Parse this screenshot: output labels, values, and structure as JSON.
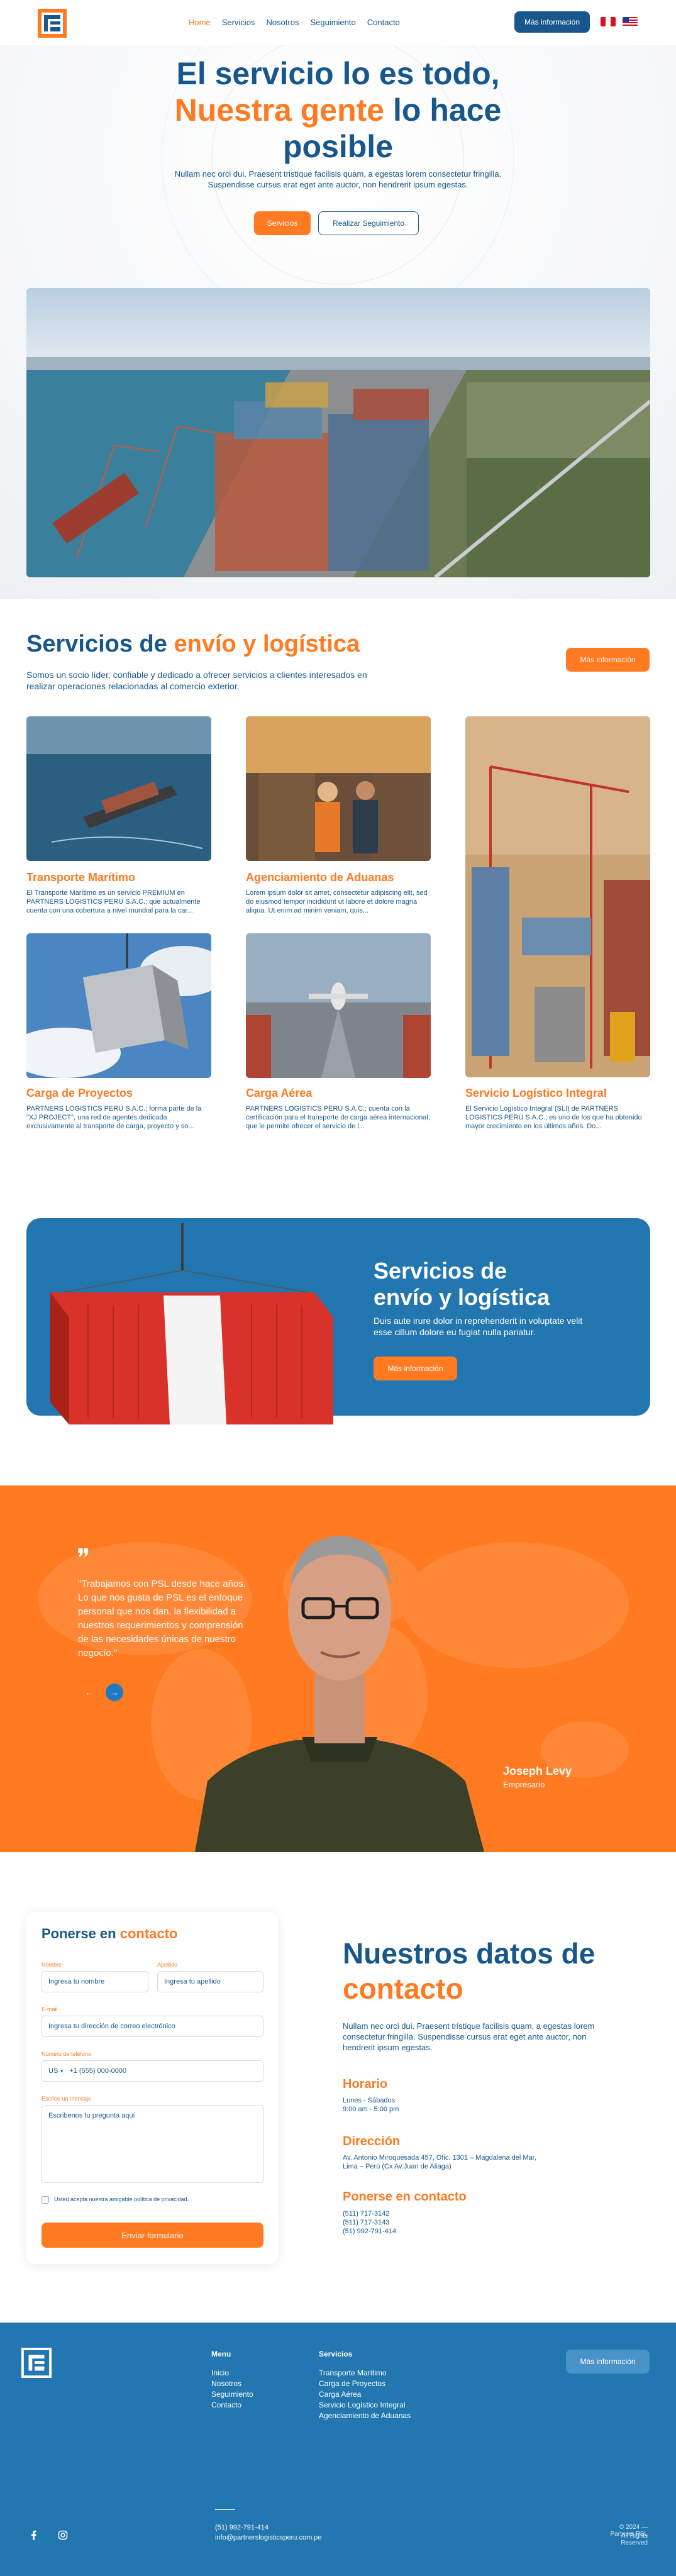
{
  "nav": {
    "items": [
      "Home",
      "Servicios",
      "Nosotros",
      "Seguimiento",
      "Contacto"
    ],
    "cta": "Más información"
  },
  "hero": {
    "title_line1": "El servicio lo es todo,",
    "title_line2_orange": "Nuestra gente",
    "title_line2_blue": "lo hace",
    "title_line3": "posible",
    "subtitle": "Nullam nec orci dui. Praesent tristique facilisis quam, a egestas lorem consectetur fringilla. Suspendisse cursus erat eget ante auctor, non hendrerit ipsum egestas.",
    "btn_primary": "Servicios",
    "btn_secondary": "Realizar Seguimiento"
  },
  "services": {
    "title_blue": "Servicios de",
    "title_orange": "envío y logística",
    "subtitle": "Somos un socio líder, confiable y dedicado a ofrecer servicios a clientes interesados en realizar operaciones relacionadas al comercio exterior.",
    "cta": "Más información",
    "cards": [
      {
        "title": "Transporte Marítimo",
        "text": "El Transporte Marítimo es un servicio PREMIUM en PARTNERS LOGISTICS PERU S.A.C.; que actualmente cuenta con una cobertura a nivel mundial para la car..."
      },
      {
        "title": "Agenciamiento de Aduanas",
        "text": "Lorem ipsum dolor sit amet, consectetur adipiscing elit, sed do eiusmod tempor incididunt ut labore et dolore magna aliqua. Ut enim ad minim veniam, quis..."
      },
      {
        "title": "Servicio Logístico Integral",
        "text": "El Servicio Logístico Integral (SLI) de PARTNERS LOGISTICS PERU S.A.C.; es uno de los que ha obtenido mayor crecimiento en los últimos años. Do..."
      },
      {
        "title": "Carga de Proyectos",
        "text": "PARTNERS LOGISTICS PERU S.A.C.; forma parte de la \"XJ PROJECT\", una red de agentes dedicada exclusivamente al transporte de carga, proyecto y so..."
      },
      {
        "title": "Carga Aérea",
        "text": "PARTNERS LOGISTICS PERU S.A.C.; cuenta con la certificación para el transporte de carga aérea internacional, que le permite ofrecer el servicio de l..."
      }
    ]
  },
  "banner": {
    "title_line1": "Servicios de",
    "title_line2": "envío y logística",
    "text": "Duis aute irure dolor in reprehenderit in voluptate velit esse cillum dolore eu fugiat nulla pariatur.",
    "cta": "Más información"
  },
  "testimonial": {
    "quote_mark": "❞",
    "text": "\"Trabajamos con PSL desde hace años. Lo que nos gusta de PSL es el enfoque personal que nos dan, la flexibilidad a nuestros requerimientos y comprensión de las necesidades únicas de nuestro negocio.\"",
    "name": "Joseph Levy",
    "role": "Empresario"
  },
  "form": {
    "title_blue": "Ponerse en",
    "title_orange": "contacto",
    "name_label": "Nombre",
    "name_placeholder": "Ingresa tu nombre",
    "last_label": "Apellido",
    "last_placeholder": "Ingresa tu apellido",
    "email_label": "E-mail",
    "email_placeholder": "Ingresa tu dirección de correo electrónico",
    "phone_label": "Número de teléfono",
    "phone_country": "US",
    "phone_placeholder": "+1 (555) 000-0000",
    "msg_label": "Escribe un mensaje",
    "msg_placeholder": "Escribenos tu pregunta aquí",
    "privacy": "Usted acepta nuestra amigable política de privacidad.",
    "submit": "Enviar formulario"
  },
  "info": {
    "title_blue": "Nuestros datos de",
    "title_orange": "contacto",
    "subtitle": "Nullam nec orci dui. Praesent tristique facilisis quam, a egestas lorem consectetur fringilla. Suspendisse cursus erat eget ante auctor, non hendrerit ipsum egestas.",
    "hours_h": "Horario",
    "hours_days": "Lunes - Sábados",
    "hours_time": "9:00 am - 5:00 pm",
    "addr_h": "Dirección",
    "addr_line1": "Av. Antonio Miroquesada 457, Ofic. 1301 – Magdalena del Mar,",
    "addr_line2": "Lima – Perú (Cx Av.Juan de Aliaga)",
    "phone_h": "Ponerse en contacto",
    "phone1": "(511) 717-3142",
    "phone2": "(511) 717-3143",
    "phone3": "(51) 992-791-414"
  },
  "footer": {
    "menu_h": "Menu",
    "menu": [
      "Inicio",
      "Nosotros",
      "Seguimiento",
      "Contacto"
    ],
    "svc_h": "Servicios",
    "svc": [
      "Transporte Marítimo",
      "Carga de Proyectos",
      "Carga Aérea",
      "Servicio Logístico Integral",
      "Agenciamiento de Aduanas"
    ],
    "cta": "Más información",
    "phone": "(51) 992-791-414",
    "email": "info@partnerslogisticsperu.com.pe",
    "copy1": "© 2024 — Partners PSL",
    "copy2": "All Rights Reserved"
  },
  "colors": {
    "brand_blue": "#17578c",
    "brand_orange": "#ff7a21",
    "footer_blue": "#2277b0"
  }
}
